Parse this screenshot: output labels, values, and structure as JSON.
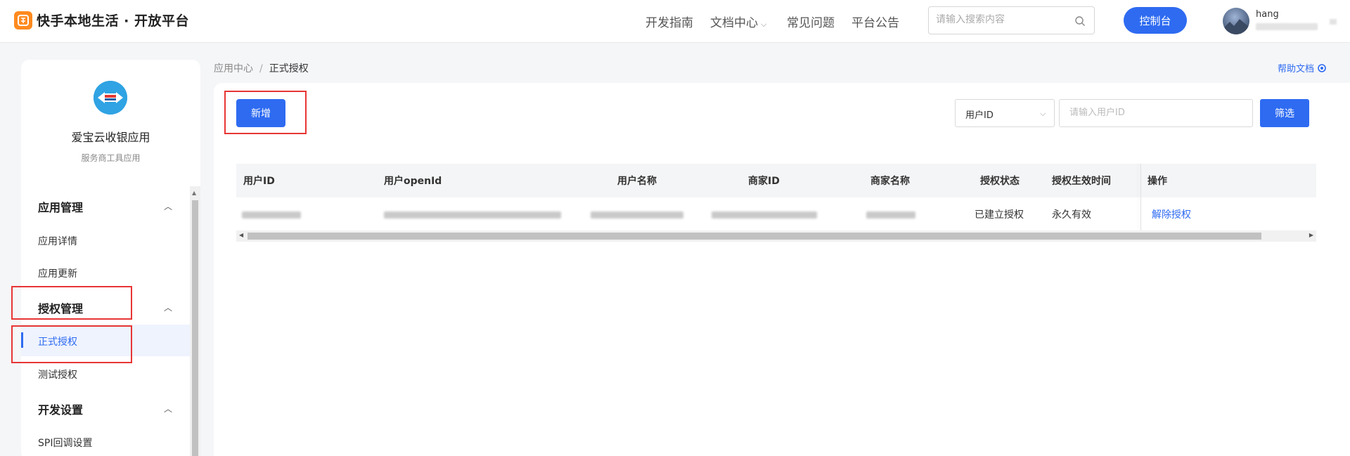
{
  "header": {
    "brand": "快手本地生活 · 开放平台",
    "nav": [
      {
        "label": "开发指南"
      },
      {
        "label": "文档中心",
        "has_dropdown": true
      },
      {
        "label": "常见问题"
      },
      {
        "label": "平台公告"
      }
    ],
    "search_placeholder": "请输入搜索内容",
    "console_label": "控制台",
    "username": "hang"
  },
  "sidebar": {
    "app_name": "爱宝云收银应用",
    "app_subtitle": "服务商工具应用",
    "groups": [
      {
        "label": "应用管理",
        "items": [
          {
            "label": "应用详情"
          },
          {
            "label": "应用更新"
          }
        ]
      },
      {
        "label": "授权管理",
        "items": [
          {
            "label": "正式授权",
            "active": true
          },
          {
            "label": "测试授权"
          }
        ]
      },
      {
        "label": "开发设置",
        "items": [
          {
            "label": "SPI回调设置"
          }
        ]
      }
    ]
  },
  "breadcrumb": {
    "parent": "应用中心",
    "sep": "/",
    "current": "正式授权"
  },
  "help_label": "帮助文档",
  "toolbar": {
    "add_label": "新增",
    "filter_field": "用户ID",
    "filter_placeholder": "请输入用户ID",
    "filter_button": "筛选"
  },
  "table": {
    "columns": [
      "用户ID",
      "用户openId",
      "用户名称",
      "商家ID",
      "商家名称",
      "授权状态",
      "授权生效时间",
      "操作"
    ],
    "rows": [
      {
        "status": "已建立授权",
        "effective_time": "永久有效",
        "action": "解除授权"
      }
    ]
  },
  "colors": {
    "accent": "#2e6bf1",
    "highlight_box": "#e83535",
    "brand_orange": "#ff8a1f"
  }
}
